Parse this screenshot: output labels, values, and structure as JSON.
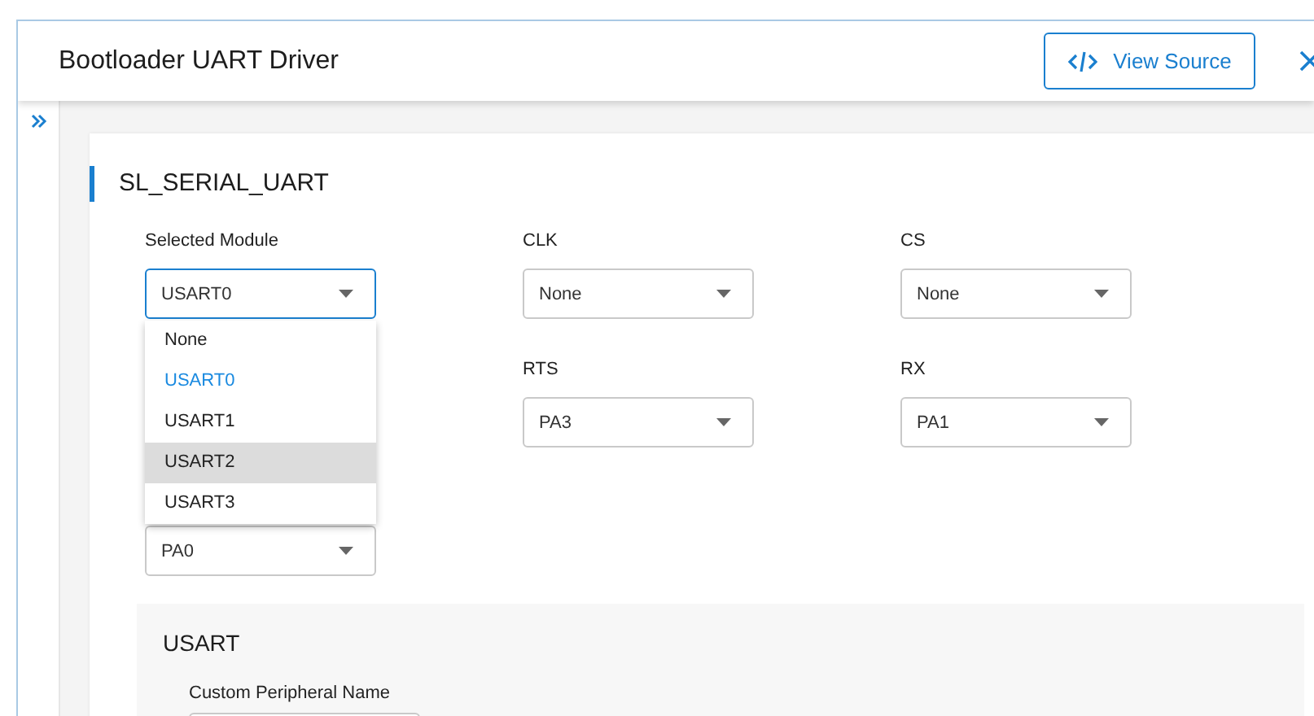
{
  "header": {
    "title": "Bootloader UART Driver",
    "view_source": "View Source"
  },
  "card": {
    "title": "SL_SERIAL_UART",
    "rows": [
      [
        {
          "kind": "select",
          "label": "Selected Module",
          "value": "USART0",
          "open": true
        },
        {
          "kind": "select",
          "label": "CLK",
          "value": "None",
          "open": false
        },
        {
          "kind": "select",
          "label": "CS",
          "value": "None",
          "open": false
        }
      ],
      [
        {
          "kind": "covered"
        },
        {
          "kind": "select",
          "label": "RTS",
          "value": "PA3",
          "open": false
        },
        {
          "kind": "select",
          "label": "RX",
          "value": "PA1",
          "open": false
        }
      ],
      [
        {
          "kind": "select",
          "value": "PA0",
          "open": false
        }
      ]
    ],
    "dropdown": [
      {
        "label": "None",
        "selected": false,
        "highlighted": false
      },
      {
        "label": "USART0",
        "selected": true,
        "highlighted": false
      },
      {
        "label": "USART1",
        "selected": false,
        "highlighted": false
      },
      {
        "label": "USART2",
        "selected": false,
        "highlighted": true
      },
      {
        "label": "USART3",
        "selected": false,
        "highlighted": false
      }
    ],
    "section": {
      "title": "USART",
      "field_label": "Custom Peripheral Name"
    }
  }
}
